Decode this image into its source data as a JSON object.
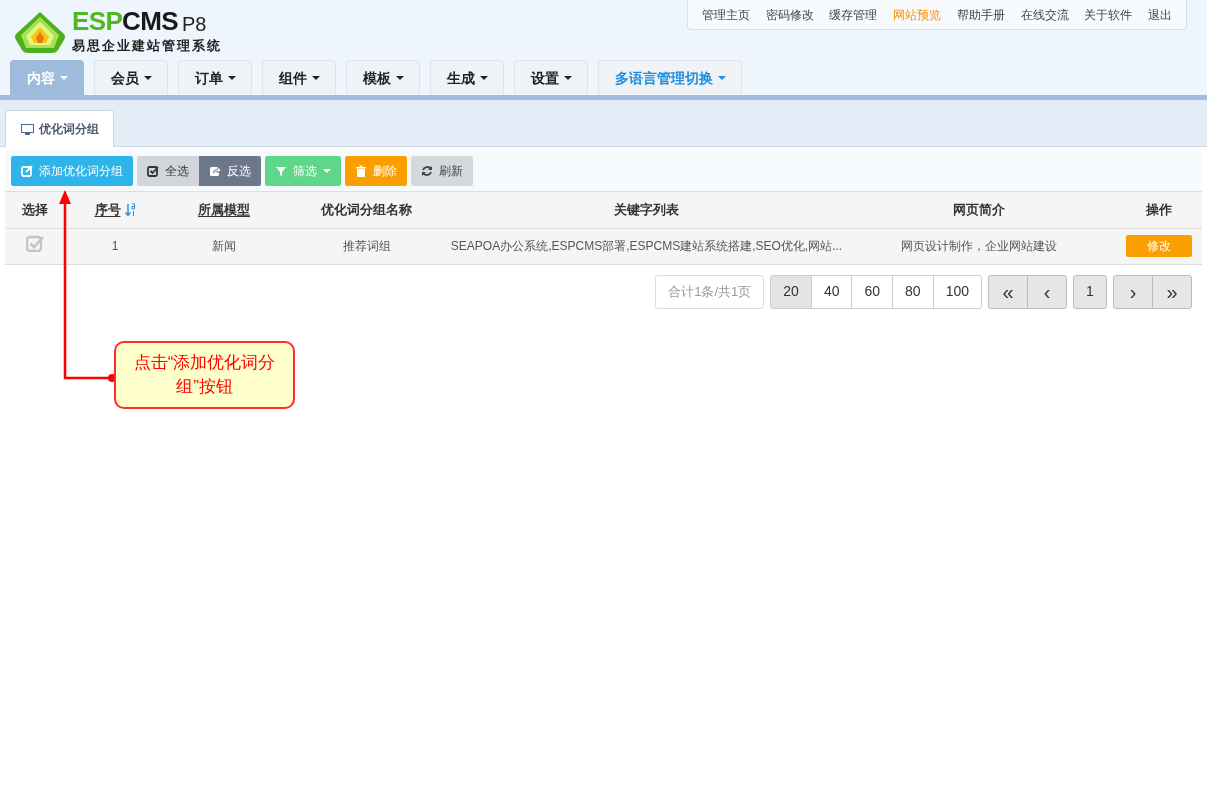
{
  "logo": {
    "wordmark": [
      {
        "text": "ESP",
        "kind": "accent"
      },
      {
        "text": "CMS",
        "kind": "plain"
      }
    ],
    "version": "P8",
    "subtitle": "易思企业建站管理系统"
  },
  "top_links": [
    {
      "label": "管理主页",
      "highlighted": false
    },
    {
      "label": "密码修改",
      "highlighted": false
    },
    {
      "label": "缓存管理",
      "highlighted": false
    },
    {
      "label": "网站预览",
      "highlighted": true
    },
    {
      "label": "帮助手册",
      "highlighted": false
    },
    {
      "label": "在线交流",
      "highlighted": false
    },
    {
      "label": "关于软件",
      "highlighted": false
    },
    {
      "label": "退出",
      "highlighted": false
    }
  ],
  "nav_tabs": [
    {
      "label": "内容",
      "selected": true,
      "kind": "menu"
    },
    {
      "label": "会员",
      "selected": false,
      "kind": "menu"
    },
    {
      "label": "订单",
      "selected": false,
      "kind": "menu"
    },
    {
      "label": "组件",
      "selected": false,
      "kind": "menu"
    },
    {
      "label": "模板",
      "selected": false,
      "kind": "menu"
    },
    {
      "label": "生成",
      "selected": false,
      "kind": "menu"
    },
    {
      "label": "设置",
      "selected": false,
      "kind": "menu"
    },
    {
      "label": "多语言管理切换",
      "selected": false,
      "kind": "language"
    }
  ],
  "page_tab": {
    "label": "优化词分组",
    "selected": true
  },
  "toolbar": [
    {
      "label": "添加优化词分组",
      "kind": "primary"
    },
    {
      "label": "全选",
      "kind": "light"
    },
    {
      "label": "反选",
      "kind": "dark"
    },
    {
      "label": "筛选",
      "kind": "success",
      "dropdown": true
    },
    {
      "label": "删除",
      "kind": "warning"
    },
    {
      "label": "刷新",
      "kind": "default"
    }
  ],
  "table": {
    "columns": [
      {
        "label": "选择",
        "sortable": false,
        "sorted": false
      },
      {
        "label": "序号",
        "sortable": true,
        "sorted": true
      },
      {
        "label": "所属模型",
        "sortable": true,
        "sorted": false
      },
      {
        "label": "优化词分组名称",
        "sortable": false,
        "sorted": false
      },
      {
        "label": "关键字列表",
        "sortable": false,
        "sorted": false
      },
      {
        "label": "网页简介",
        "sortable": false,
        "sorted": false
      },
      {
        "label": "操作",
        "sortable": false,
        "sorted": false
      }
    ],
    "rows": [
      {
        "checked": false,
        "id": "1",
        "model": "新闻",
        "name": "推荐词组",
        "keywords": "SEAPOA办公系统,ESPCMS部署,ESPCMS建站系统搭建,SEO优化,网站...",
        "description": "网页设计制作，企业网站建设",
        "action": "修改"
      }
    ]
  },
  "pagination": {
    "summary": "合计1条/共1页",
    "page_sizes": [
      {
        "label": "20",
        "selected": true
      },
      {
        "label": "40",
        "selected": false
      },
      {
        "label": "60",
        "selected": false
      },
      {
        "label": "80",
        "selected": false
      },
      {
        "label": "100",
        "selected": false
      }
    ],
    "nav": [
      [
        {
          "label": "«",
          "kind": "first"
        },
        {
          "label": "‹",
          "kind": "prev"
        }
      ],
      [
        {
          "label": "1",
          "kind": "page"
        }
      ],
      [
        {
          "label": "›",
          "kind": "next"
        },
        {
          "label": "»",
          "kind": "last"
        }
      ]
    ]
  },
  "callout": {
    "text": "点击“添加优化词分组”按钮"
  }
}
